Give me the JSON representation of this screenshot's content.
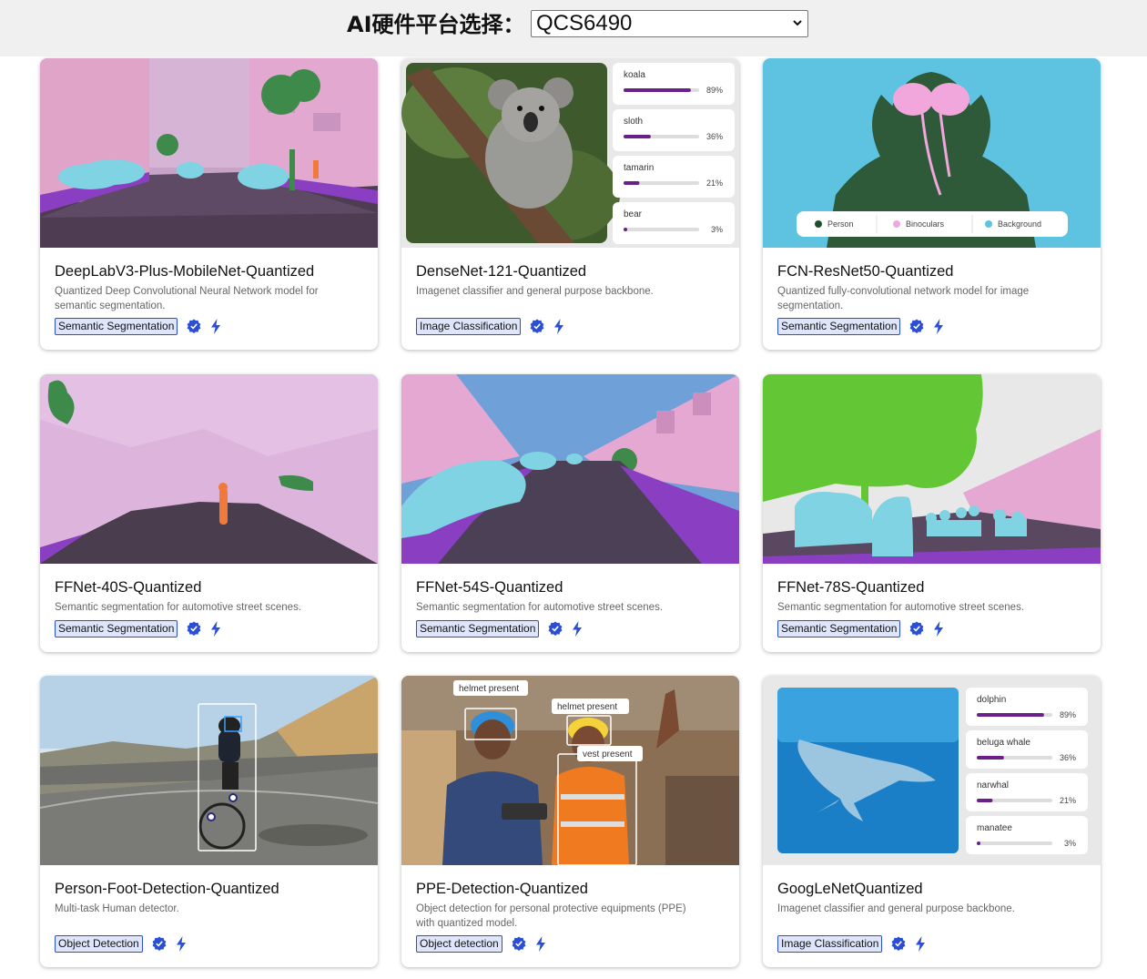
{
  "header": {
    "platform_label": "AI硬件平台选择：",
    "platform_value": "QCS6490"
  },
  "cards": [
    {
      "title": "DeepLabV3-Plus-MobileNet-Quantized",
      "description": "Quantized Deep Convolutional Neural Network model for semantic segmentation.",
      "tag": "Semantic Segmentation"
    },
    {
      "title": "DenseNet-121-Quantized",
      "description": "Imagenet classifier and general purpose backbone.",
      "tag": "Image Classification",
      "predictions": [
        {
          "label": "koala",
          "pct": "89%",
          "value": 0.89
        },
        {
          "label": "sloth",
          "pct": "36%",
          "value": 0.36
        },
        {
          "label": "tamarin",
          "pct": "21%",
          "value": 0.21
        },
        {
          "label": "bear",
          "pct": "3%",
          "value": 0.03
        }
      ]
    },
    {
      "title": "FCN-ResNet50-Quantized",
      "description": "Quantized fully-convolutional network model for image segmentation.",
      "tag": "Semantic Segmentation",
      "legend": [
        "Person",
        "Binoculars",
        "Background"
      ]
    },
    {
      "title": "FFNet-40S-Quantized",
      "description": "Semantic segmentation for automotive street scenes.",
      "tag": "Semantic Segmentation"
    },
    {
      "title": "FFNet-54S-Quantized",
      "description": "Semantic segmentation for automotive street scenes.",
      "tag": "Semantic Segmentation"
    },
    {
      "title": "FFNet-78S-Quantized",
      "description": "Semantic segmentation for automotive street scenes.",
      "tag": "Semantic Segmentation"
    },
    {
      "title": "Person-Foot-Detection-Quantized",
      "description": "Multi-task Human detector.",
      "tag": "Object Detection"
    },
    {
      "title": "PPE-Detection-Quantized",
      "description": "Object detection for personal protective equipments (PPE) with quantized model.",
      "tag": "Object detection",
      "labels": [
        "helmet present",
        "helmet present",
        "vest present"
      ]
    },
    {
      "title": "GoogLeNetQuantized",
      "description": "Imagenet classifier and general purpose backbone.",
      "tag": "Image Classification",
      "predictions": [
        {
          "label": "dolphin",
          "pct": "89%",
          "value": 0.89
        },
        {
          "label": "beluga whale",
          "pct": "36%",
          "value": 0.36
        },
        {
          "label": "narwhal",
          "pct": "21%",
          "value": 0.21
        },
        {
          "label": "manatee",
          "pct": "3%",
          "value": 0.03
        }
      ]
    }
  ],
  "icons": {
    "verified": "verified-badge-icon",
    "bolt": "lightning-bolt-icon"
  },
  "colors": {
    "tag_border": "#2a4fd6",
    "tag_bg": "#dfe6fb",
    "icon_blue": "#2a4fd6",
    "seg_pink": "#e3b3e3",
    "seg_purple": "#8a3fc2",
    "seg_cyan": "#7fd3e3",
    "seg_green": "#63c735"
  }
}
